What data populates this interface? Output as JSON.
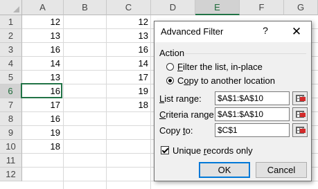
{
  "sheet": {
    "columns": [
      "A",
      "B",
      "C",
      "D",
      "E",
      "F",
      "G"
    ],
    "selected_column": "E",
    "rows": [
      "1",
      "2",
      "3",
      "4",
      "5",
      "6",
      "7",
      "8",
      "9",
      "10",
      "11",
      "12"
    ],
    "selected_row": "6",
    "column_a": [
      "12",
      "13",
      "16",
      "14",
      "13",
      "16",
      "17",
      "16",
      "19",
      "18"
    ],
    "column_c": [
      "12",
      "13",
      "16",
      "14",
      "17",
      "19",
      "18"
    ]
  },
  "dialog": {
    "title": "Advanced Filter",
    "help_label": "?",
    "close_label": "✕",
    "action_label": "Action",
    "radio_filter": {
      "u": "F",
      "rest": "ilter the list, in-place",
      "checked": false
    },
    "radio_copy": {
      "pre": "C",
      "u": "o",
      "rest": "py to another location",
      "checked": true
    },
    "list_range": {
      "u": "L",
      "rest": "ist range:",
      "value": "$A$1:$A$10"
    },
    "criteria_range": {
      "u": "C",
      "rest": "riteria range:",
      "value": "$A$1:$A$10"
    },
    "copy_to": {
      "pre": "Copy ",
      "u": "t",
      "rest": "o:",
      "value": "$C$1"
    },
    "unique": {
      "pre": "Unique ",
      "u": "r",
      "rest": "ecords only",
      "checked": true
    },
    "ok_label": "OK",
    "cancel_label": "Cancel",
    "picker_icon": "range-picker-icon"
  }
}
